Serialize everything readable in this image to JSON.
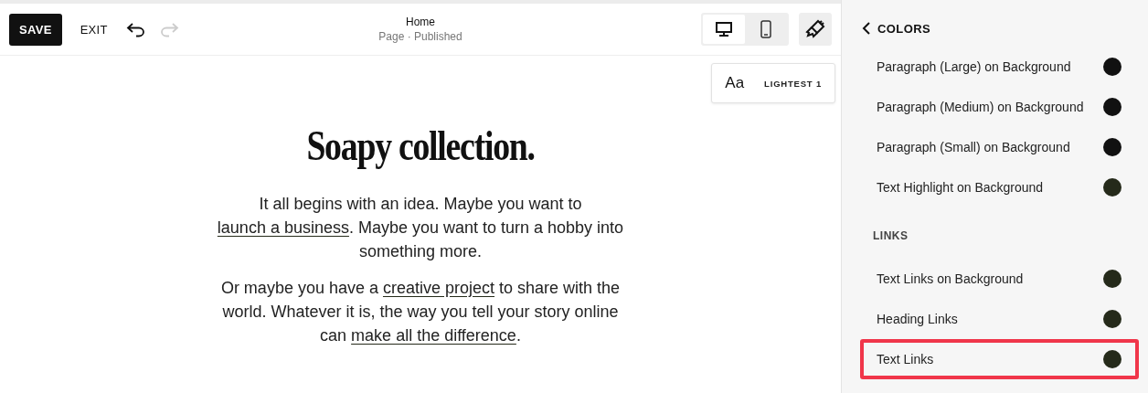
{
  "toolbar": {
    "save": "SAVE",
    "exit": "EXIT",
    "undo_enabled": true,
    "redo_enabled": false,
    "page_title": "Home",
    "page_status": "Page · Published",
    "devices": [
      {
        "kind": "desktop",
        "selected": true
      },
      {
        "kind": "mobile",
        "selected": false
      }
    ]
  },
  "font_badge": {
    "sample": "Aa",
    "label": "LIGHTEST 1"
  },
  "page": {
    "heading": "Soapy collection.",
    "paragraphs": [
      [
        {
          "kind": "text",
          "text": "It all begins with an idea. Maybe you want to "
        },
        {
          "kind": "link",
          "text": "launch a business"
        },
        {
          "kind": "text",
          "text": ". Maybe you want to turn a hobby into something more."
        }
      ],
      [
        {
          "kind": "text",
          "text": "Or maybe you have a "
        },
        {
          "kind": "link",
          "text": "creative project"
        },
        {
          "kind": "text",
          "text": " to share with the world. Whatever it is, the way you tell your story online can "
        },
        {
          "kind": "link",
          "text": "make all the difference"
        },
        {
          "kind": "text",
          "text": "."
        }
      ]
    ]
  },
  "panel": {
    "back": "COLORS",
    "items": [
      {
        "kind": "color",
        "label": "Paragraph (Large) on Background",
        "color": "#111111",
        "selected": false
      },
      {
        "kind": "color",
        "label": "Paragraph (Medium) on Background",
        "color": "#111111",
        "selected": false
      },
      {
        "kind": "color",
        "label": "Paragraph (Small) on Background",
        "color": "#111111",
        "selected": false
      },
      {
        "kind": "color",
        "label": "Text Highlight on Background",
        "color": "#252a1a",
        "selected": false
      },
      {
        "kind": "section",
        "label": "LINKS"
      },
      {
        "kind": "color",
        "label": "Text Links on Background",
        "color": "#252a1a",
        "selected": false
      },
      {
        "kind": "color",
        "label": "Heading Links",
        "color": "#252a1a",
        "selected": false
      },
      {
        "kind": "color",
        "label": "Text Links",
        "color": "#252a1a",
        "selected": true
      }
    ]
  }
}
